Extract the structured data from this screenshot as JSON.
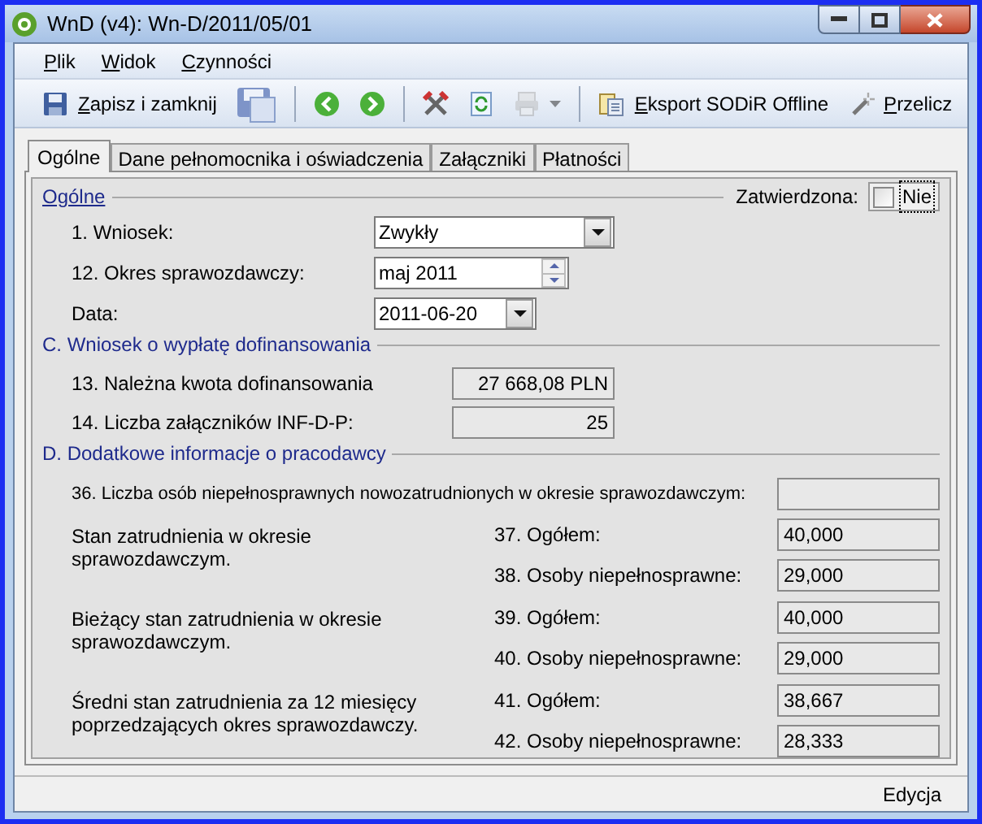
{
  "window": {
    "title": "WnD (v4): Wn-D/2011/05/01"
  },
  "menu": [
    {
      "label": "Plik",
      "access_key": true
    },
    {
      "label": "Widok",
      "access_key": true
    },
    {
      "label": "Czynności",
      "access_key": true
    }
  ],
  "toolbar": [
    {
      "kind": "save",
      "label": "Zapisz i zamknij",
      "access_key": true,
      "disabled": false
    },
    {
      "kind": "save-large",
      "disabled": false
    },
    {
      "kind": "separator"
    },
    {
      "kind": "back",
      "disabled": false
    },
    {
      "kind": "forward",
      "disabled": false
    },
    {
      "kind": "separator"
    },
    {
      "kind": "tools",
      "disabled": false
    },
    {
      "kind": "refresh",
      "disabled": false
    },
    {
      "kind": "print",
      "disabled": true
    },
    {
      "kind": "separator"
    },
    {
      "kind": "export",
      "label": "Eksport SODiR Offline",
      "access_key": true,
      "disabled": false
    },
    {
      "kind": "wand",
      "label": "Przelicz",
      "access_key": true,
      "disabled": false
    }
  ],
  "tabs": [
    {
      "label": "Ogólne",
      "selected": true
    },
    {
      "label": "Dane pełnomocnika i oświadczenia",
      "selected": false
    },
    {
      "label": "Załączniki",
      "selected": false
    },
    {
      "label": "Płatności",
      "selected": false
    }
  ],
  "general": {
    "title": "Ogólne",
    "approved": {
      "label": "Zatwierdzona:",
      "checked": false,
      "text": "Nie"
    },
    "fields": [
      {
        "kind": "dropdown",
        "label": "1. Wniosek:",
        "value": "Zwykły"
      },
      {
        "kind": "spinner",
        "label": "12. Okres sprawozdawczy:",
        "value": "maj 2011"
      },
      {
        "kind": "date",
        "label": "Data:",
        "value": "2011-06-20"
      }
    ]
  },
  "section_c": {
    "title": "C. Wniosek o wypłatę dofinansowania",
    "fields": [
      {
        "label": "13. Należna kwota dofinansowania",
        "value": "27 668,08 PLN"
      },
      {
        "label": "14. Liczba załączników INF-D-P:",
        "value": "25"
      }
    ]
  },
  "section_d": {
    "title": "D. Dodatkowe informacje o pracodawcy",
    "field_36": {
      "label": "36. Liczba osób niepełnosprawnych nowozatrudnionych w okresie sprawozdawczym:"
    },
    "groups": [
      {
        "description": "Stan zatrudnienia w okresie sprawozdawczym.",
        "fields": [
          {
            "label": "37. Ogółem:",
            "value": "40,000"
          },
          {
            "label": "38. Osoby niepełnosprawne:",
            "value": "29,000"
          }
        ]
      },
      {
        "description": "Bieżący stan zatrudnienia w okresie sprawozdawczym.",
        "fields": [
          {
            "label": "39. Ogółem:",
            "value": "40,000"
          },
          {
            "label": "40. Osoby niepełnosprawne:",
            "value": "29,000"
          }
        ]
      },
      {
        "description": "Średni stan zatrudnienia za 12 miesięcy poprzedzających okres sprawozdawczy.",
        "fields": [
          {
            "label": "41. Ogółem:",
            "value": "38,667"
          },
          {
            "label": "42. Osoby niepełnosprawne:",
            "value": "28,333"
          }
        ]
      }
    ]
  },
  "status_bar": {
    "text": "Edycja"
  }
}
